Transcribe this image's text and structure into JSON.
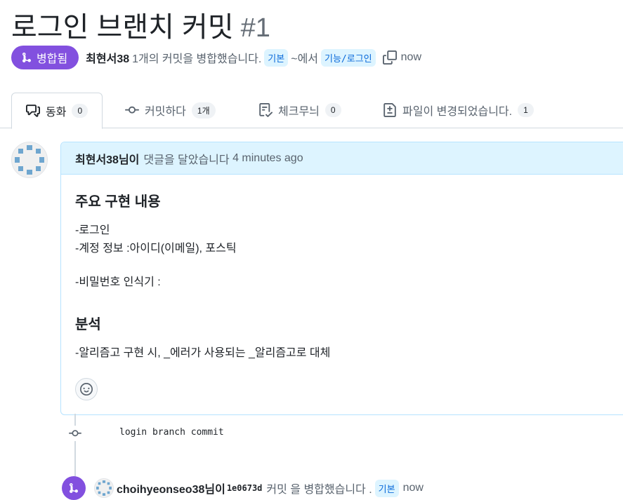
{
  "pr": {
    "title": "로그인 브랜치 커밋",
    "number": "#1",
    "state_label": "병합됨",
    "author": "최현서38",
    "summary": "1개의 커밋을 병합했습니다.",
    "base_branch": "기본",
    "from_text": "~에서",
    "head_branch": "기능/로그인",
    "time": "now"
  },
  "tabs": [
    {
      "label": "동화",
      "count": "0",
      "icon": "comment-discussion-icon"
    },
    {
      "label": "커밋하다",
      "count": "1개",
      "icon": "git-commit-icon"
    },
    {
      "label": "체크무늬",
      "count": "0",
      "icon": "checklist-icon"
    },
    {
      "label": "파일이 변경되었습니다.",
      "count": "1",
      "icon": "file-diff-icon"
    }
  ],
  "comment": {
    "author": "최현서38님이",
    "action": "댓글을 달았습니다",
    "time": "4 minutes ago",
    "heading1": "주요 구현 내용",
    "line1": "-로그인",
    "line2": "-계정 정보 :아이디(이메일), 포스틱",
    "line3": "-비밀번호 인식기 :",
    "heading2": "분석",
    "line4": "-알리즘고 구현 시, _에러가 사용되는 _알리즘고로 대체"
  },
  "commit": {
    "message": "login branch commit"
  },
  "merge_event": {
    "user": "choihyeonseo38님이",
    "sha": "1e0673d",
    "action": "커밋 을 병합했습니다 .",
    "branch": "기본",
    "time": "now"
  },
  "colors": {
    "merged_purple": "#8250df",
    "branch_bg": "#ddf4ff",
    "branch_fg": "#0969da"
  }
}
